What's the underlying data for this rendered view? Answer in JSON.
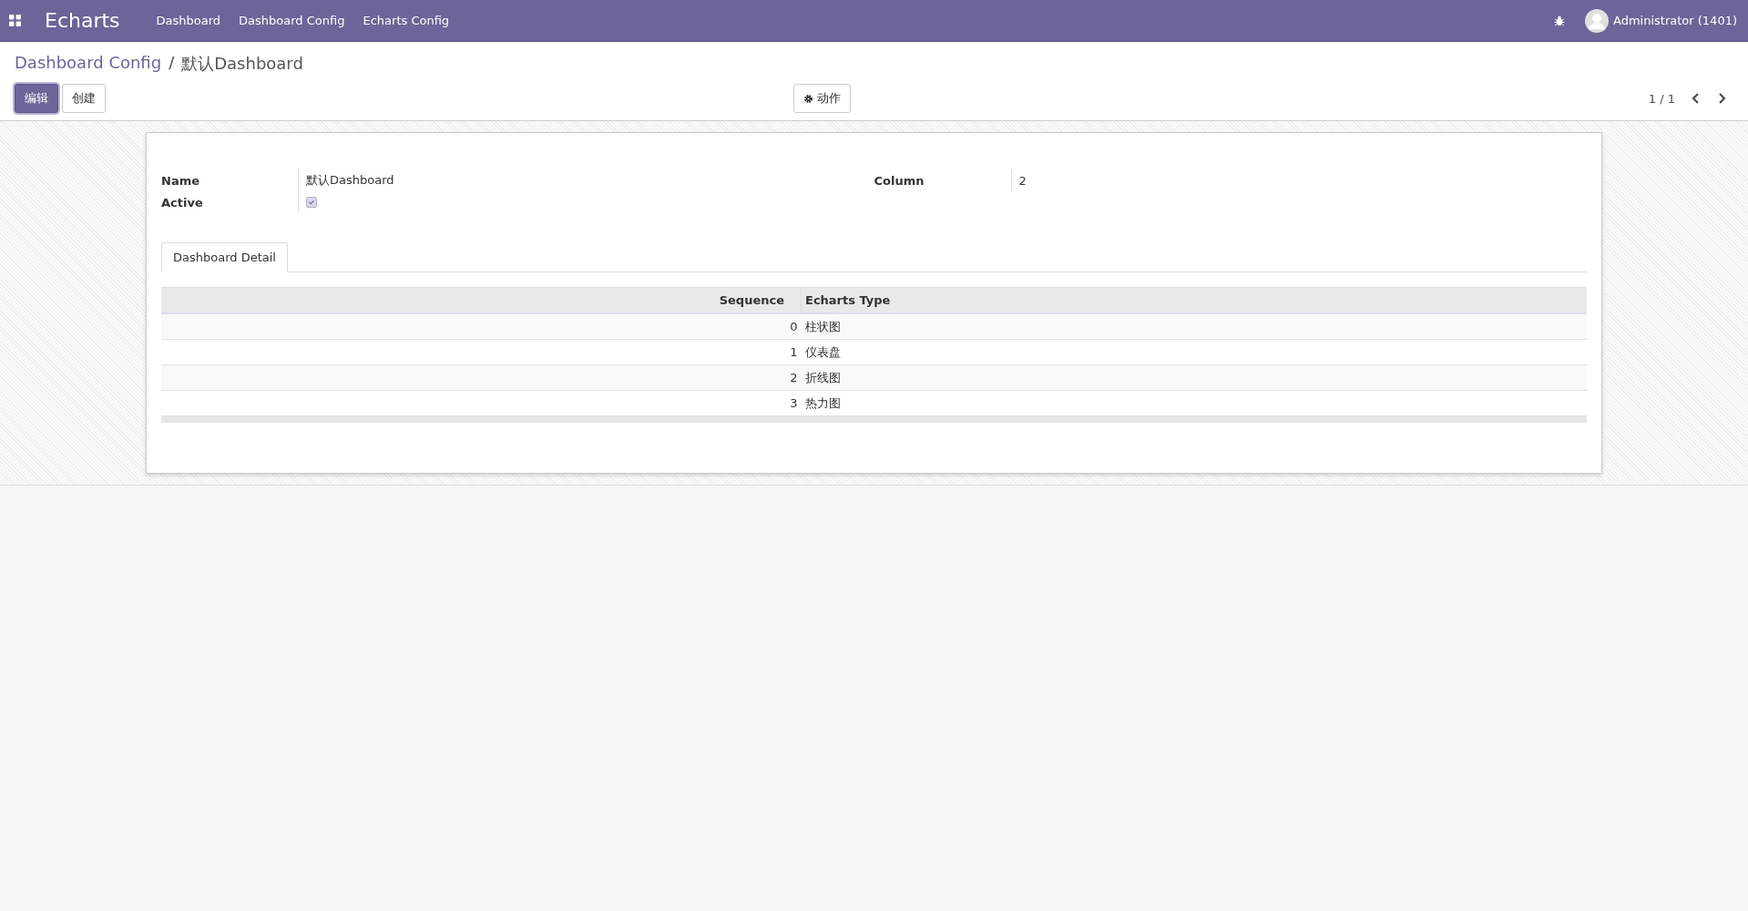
{
  "navbar": {
    "brand": "Echarts",
    "menu": [
      "Dashboard",
      "Dashboard Config",
      "Echarts Config"
    ],
    "user": "Administrator (1401)"
  },
  "breadcrumb": {
    "parent": "Dashboard Config",
    "separator": "/",
    "current": "默认Dashboard"
  },
  "buttons": [
    {
      "label": "编辑",
      "primary": true
    },
    {
      "label": "创建",
      "primary": false
    }
  ],
  "action_button": "动作",
  "pager": "1 / 1",
  "form": {
    "name_label": "Name",
    "name": "默认Dashboard",
    "active_label": "Active",
    "active": true,
    "column_label": "Column",
    "column": "2"
  },
  "tabs": [
    {
      "label": "Dashboard Detail",
      "selected": true
    }
  ],
  "table": {
    "columns": [
      "Sequence",
      "Echarts Type"
    ],
    "rows": [
      [
        "0",
        "柱状图"
      ],
      [
        "1",
        "仪表盘"
      ],
      [
        "2",
        "折线图"
      ],
      [
        "3",
        "热力图"
      ]
    ]
  }
}
